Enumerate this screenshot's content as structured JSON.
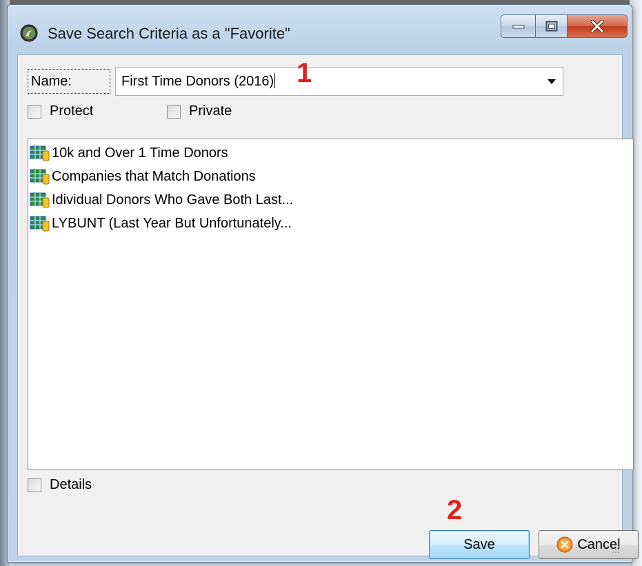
{
  "window": {
    "title": "Save Search Criteria as a \"Favorite\""
  },
  "form": {
    "name_label": "Name:",
    "name_value": "First Time Donors (2016)",
    "protect_label": "Protect",
    "private_label": "Private",
    "details_label": "Details"
  },
  "favorites": [
    {
      "label": "10k and Over 1 Time Donors",
      "icon": "grid-table-icon"
    },
    {
      "label": "Companies that Match Donations",
      "icon": "grid-table-icon"
    },
    {
      "label": "Idividual Donors Who Gave Both Last...",
      "icon": "grid-table-icon"
    },
    {
      "label": "LYBUNT (Last Year But Unfortunately...",
      "icon": "grid-table-icon"
    }
  ],
  "buttons": {
    "save_label": "Save",
    "cancel_label": "Cancel"
  },
  "annotations": {
    "step1": "1",
    "step2": "2"
  },
  "colors": {
    "annotation": "#e0201b",
    "close_button": "#c0391c"
  }
}
